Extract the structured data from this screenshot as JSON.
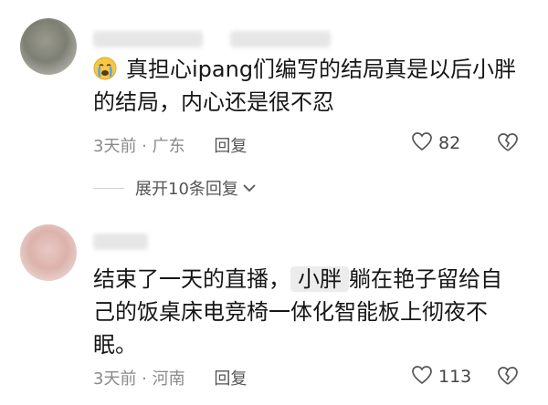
{
  "comments": [
    {
      "text": "真担心ipang们编写的结局真是以后小胖的结局，内心还是很不忍",
      "time": "3天前",
      "location": "广东",
      "reply_label": "回复",
      "likes": "82",
      "emoji_icon": "crying-face-icon",
      "replies_toggle": "展开10条回复"
    },
    {
      "text_before": "结束了一天的直播，",
      "mention": "小胖",
      "text_after": "躺在艳子留给自己的饭桌床电竞椅一体化智能板上彻夜不眠。",
      "time": "3天前",
      "location": "河南",
      "reply_label": "回复",
      "likes": "113"
    }
  ],
  "meta_separator": " · "
}
